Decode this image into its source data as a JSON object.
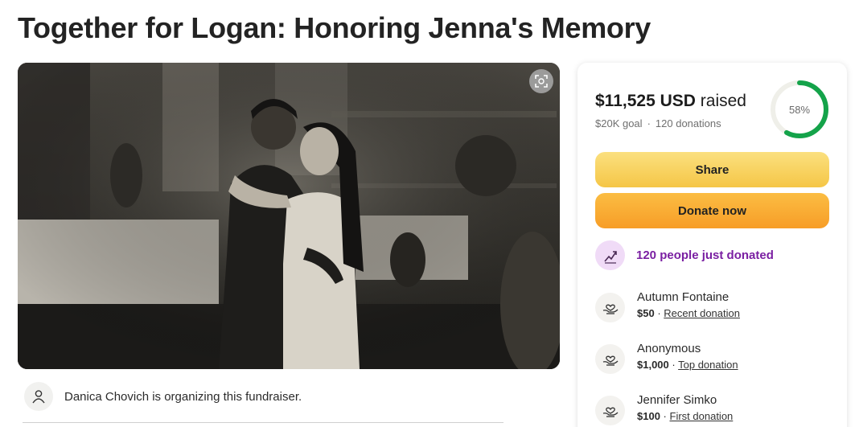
{
  "page": {
    "title": "Together for Logan: Honoring Jenna's Memory"
  },
  "organizer": {
    "text": "Danica Chovich is organizing this fundraiser."
  },
  "donation_card": {
    "raised_amount": "$11,525 USD",
    "raised_suffix": "raised",
    "goal": "$20K goal",
    "separator": "·",
    "donations_count": "120 donations",
    "progress_percent": 58,
    "progress_label": "58%",
    "share_label": "Share",
    "donate_label": "Donate now",
    "recent_activity": "120 people just donated",
    "donors": [
      {
        "name": "Autumn Fontaine",
        "amount": "$50",
        "sep": "·",
        "tag": "Recent donation"
      },
      {
        "name": "Anonymous",
        "amount": "$1,000",
        "sep": "·",
        "tag": "Top donation"
      },
      {
        "name": "Jennifer Simko",
        "amount": "$100",
        "sep": "·",
        "tag": "First donation"
      }
    ]
  },
  "colors": {
    "progress_green": "#14a34a",
    "progress_track": "#efefe9",
    "share_yellow": "#f8d466",
    "donate_orange": "#f9aa33",
    "recent_purple": "#7a1fa2",
    "recent_bg": "#f0dbf7"
  },
  "icons": {
    "zoom": "expand-view-icon",
    "organizer": "person-icon",
    "recent": "trending-up-icon",
    "donor": "heart-hand-icon"
  }
}
